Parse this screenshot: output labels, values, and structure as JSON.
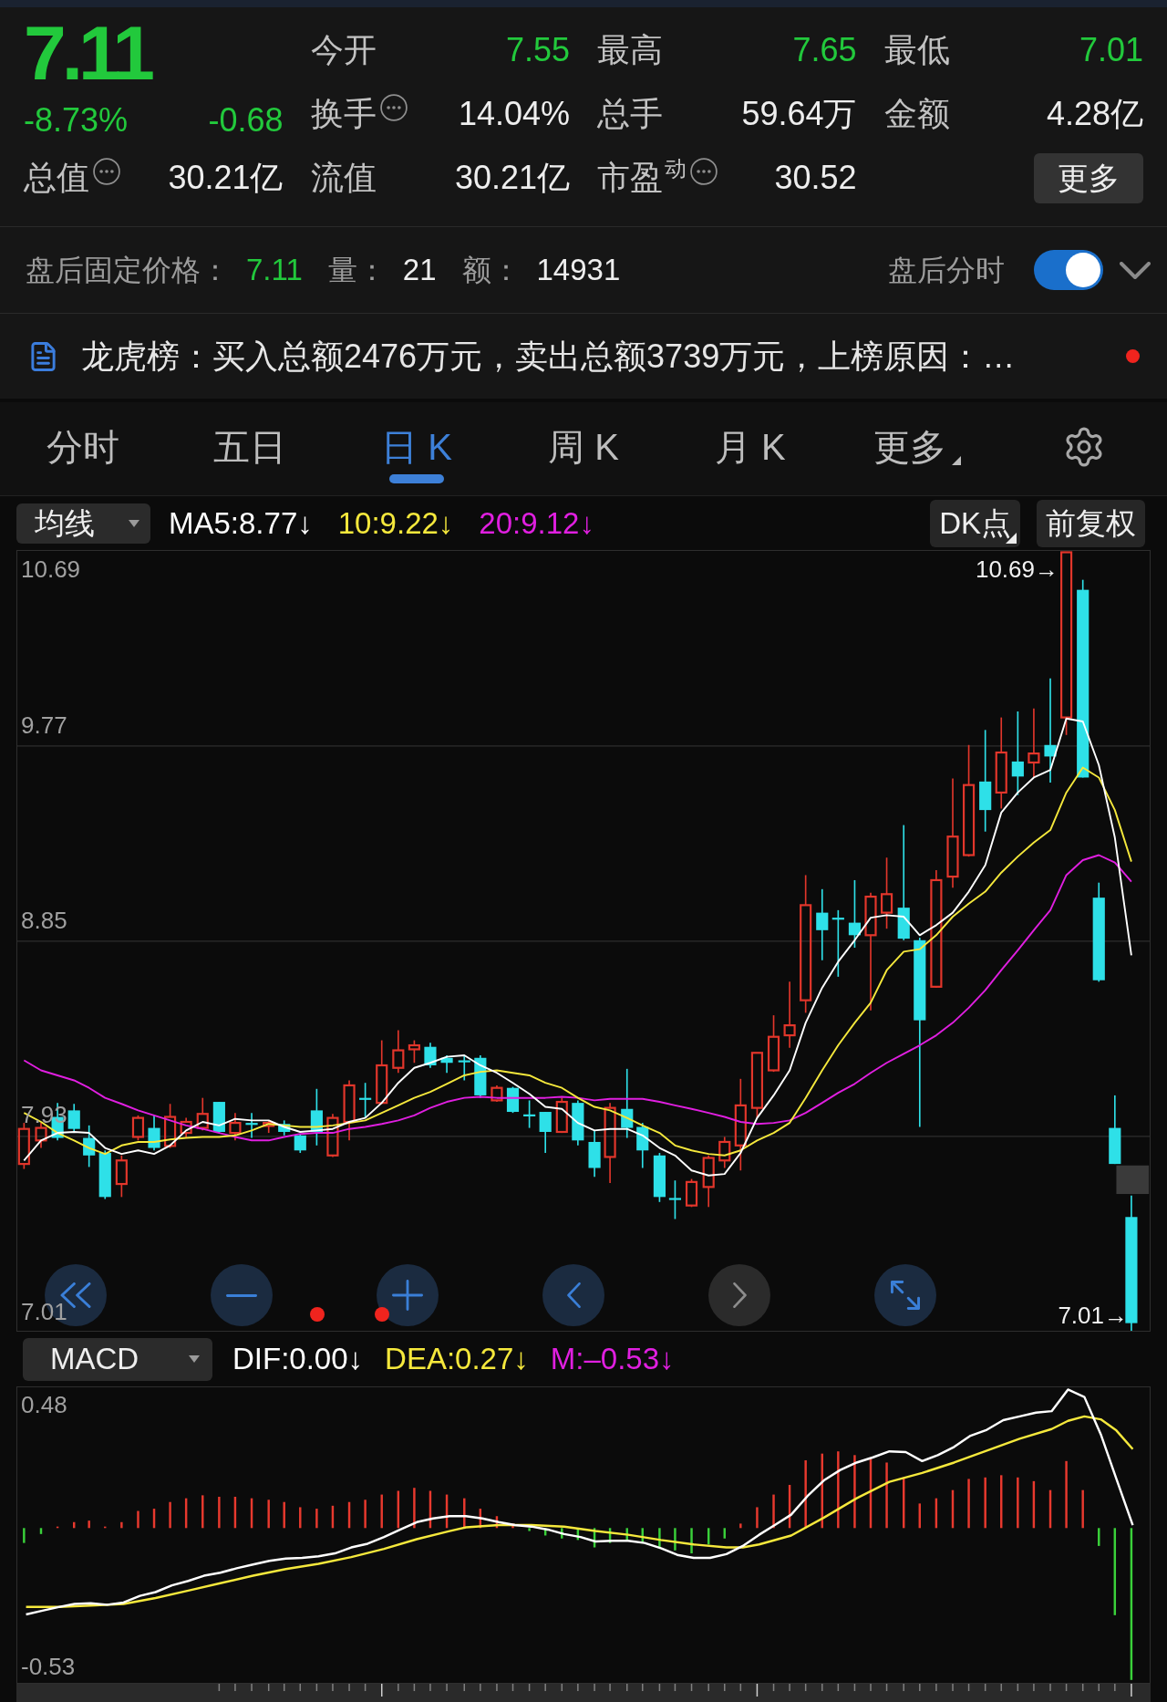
{
  "quote": {
    "price": "7.11",
    "change_percent": "-8.73%",
    "change": "-0.68"
  },
  "stats": [
    {
      "label": "今开",
      "value": "7.55",
      "color": "#22c93c",
      "info": false
    },
    {
      "label": "最高",
      "value": "7.65",
      "color": "#22c93c",
      "info": false
    },
    {
      "label": "最低",
      "value": "7.01",
      "color": "#22c93c",
      "info": false
    },
    {
      "label": "换手",
      "value": "14.04%",
      "color": "#eeeeee",
      "info": true
    },
    {
      "label": "总手",
      "value": "59.64万",
      "color": "#eeeeee",
      "info": false
    },
    {
      "label": "金额",
      "value": "4.28亿",
      "color": "#eeeeee",
      "info": false
    },
    {
      "label": "总值",
      "value": "30.21亿",
      "color": "#eeeeee",
      "info": true
    },
    {
      "label": "流值",
      "value": "30.21亿",
      "color": "#eeeeee",
      "info": false
    },
    {
      "label": "市盈$^{动}$",
      "value": "30.52",
      "color": "#eeeeee",
      "info": true
    }
  ],
  "more_button": "更多",
  "after_hours": {
    "items": [
      {
        "label": "盘后固定价格：",
        "value": "7.11",
        "kind": "price"
      },
      {
        "label": "量：",
        "value": "21",
        "kind": "plain"
      },
      {
        "label": "额：",
        "value": "14931",
        "kind": "plain"
      }
    ],
    "toggle_label": "盘后分时",
    "toggle_on": true
  },
  "notice": {
    "text": "龙虎榜：买入总额2476万元，卖出总额3739万元，上榜原因：…",
    "unread": true
  },
  "tabs": [
    {
      "label": "分时",
      "selected": false,
      "dropdown": false
    },
    {
      "label": "五日",
      "selected": false,
      "dropdown": false
    },
    {
      "label": "日 K",
      "selected": true,
      "dropdown": false
    },
    {
      "label": "周 K",
      "selected": false,
      "dropdown": false
    },
    {
      "label": "月 K",
      "selected": false,
      "dropdown": false
    },
    {
      "label": "更多",
      "selected": false,
      "dropdown": true
    }
  ],
  "indicator_bar": {
    "selector": "均线",
    "readings": [
      {
        "text": "MA5:8.77↓",
        "color": "#ffffff"
      },
      {
        "text": "10:9.22↓",
        "color": "#f5e83c"
      },
      {
        "text": "20:9.12↓",
        "color": "#e01fe0"
      }
    ],
    "buttons": [
      {
        "label": "DK点",
        "corner_mark": true
      },
      {
        "label": "前复权",
        "corner_mark": false
      }
    ]
  },
  "price_chart": {
    "axis_labels": [
      "10.69",
      "9.77",
      "8.85",
      "7.93",
      "7.01"
    ],
    "high_label": "10.69→",
    "low_label": "7.01→",
    "controls": [
      {
        "kind": "rewind",
        "disabled": false
      },
      {
        "kind": "zoom_out",
        "disabled": false
      },
      {
        "kind": "zoom_in",
        "disabled": false
      },
      {
        "kind": "back",
        "disabled": false
      },
      {
        "kind": "forward",
        "disabled": true
      },
      {
        "kind": "fullscreen",
        "disabled": false
      }
    ]
  },
  "macd": {
    "selector": "MACD",
    "readings": [
      {
        "text": "DIF:0.00↓",
        "color": "#ffffff"
      },
      {
        "text": "DEA:0.27↓",
        "color": "#f5e83c"
      },
      {
        "text": "M:–0.53↓",
        "color": "#e01fe0"
      }
    ],
    "axis_labels": [
      "0.48",
      "-0.53"
    ]
  }
}
